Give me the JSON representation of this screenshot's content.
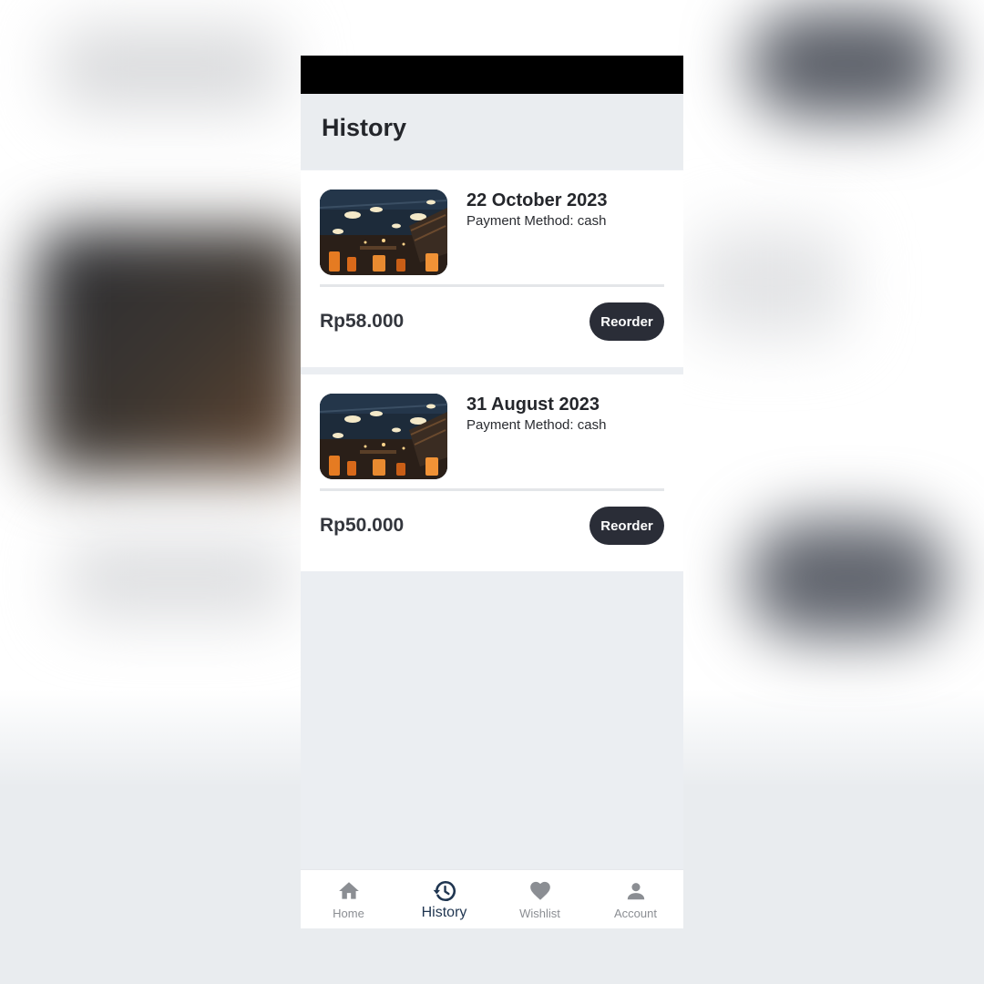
{
  "page": {
    "title": "History"
  },
  "orders": [
    {
      "date": "22 October 2023",
      "payment_method": "Payment Method: cash",
      "price": "Rp58.000",
      "action_label": "Reorder"
    },
    {
      "date": "31 August 2023",
      "payment_method": "Payment Method: cash",
      "price": "Rp50.000",
      "action_label": "Reorder"
    }
  ],
  "bottom_nav": {
    "active": "History",
    "items": [
      {
        "label": "Home",
        "icon": "home-icon"
      },
      {
        "label": "History",
        "icon": "history-icon"
      },
      {
        "label": "Wishlist",
        "icon": "heart-icon"
      },
      {
        "label": "Account",
        "icon": "account-icon"
      }
    ]
  },
  "colors": {
    "accent": "#1f3550",
    "button": "#2a2d37",
    "inactive": "#8b8e93",
    "background": "#ebeef2"
  }
}
